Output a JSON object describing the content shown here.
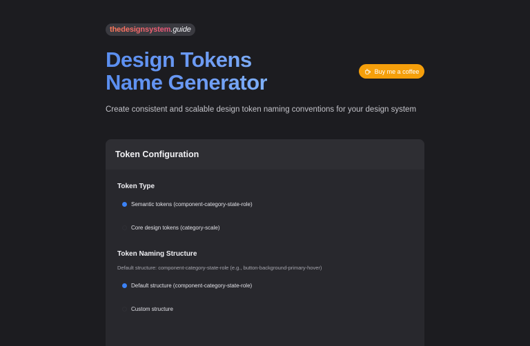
{
  "brand": {
    "main": "thedesignsystem",
    "suffix": ".guide"
  },
  "hero": {
    "title_line1": "Design Tokens",
    "title_line2": "Name Generator",
    "subtitle": "Create consistent and scalable design token naming conventions for your design system"
  },
  "coffee_button": {
    "label": "Buy me a coffee",
    "icon": "coffee-cup-icon",
    "color": "#f59f0b"
  },
  "card": {
    "title": "Token Configuration",
    "token_type": {
      "title": "Token Type",
      "options": [
        {
          "label": "Semantic tokens (component-category-state-role)",
          "selected": true
        },
        {
          "label": "Core design tokens (category-scale)",
          "selected": false
        }
      ]
    },
    "naming_structure": {
      "title": "Token Naming Structure",
      "helper": "Default structure: component-category-state-role (e.g., button-background-primary-hover)",
      "options": [
        {
          "label": "Default structure (component-category-state-role)",
          "selected": true
        },
        {
          "label": "Custom structure",
          "selected": false
        }
      ]
    }
  },
  "colors": {
    "accent": "#3b82f6",
    "background": "#1c1c20",
    "card": "#28282d"
  }
}
